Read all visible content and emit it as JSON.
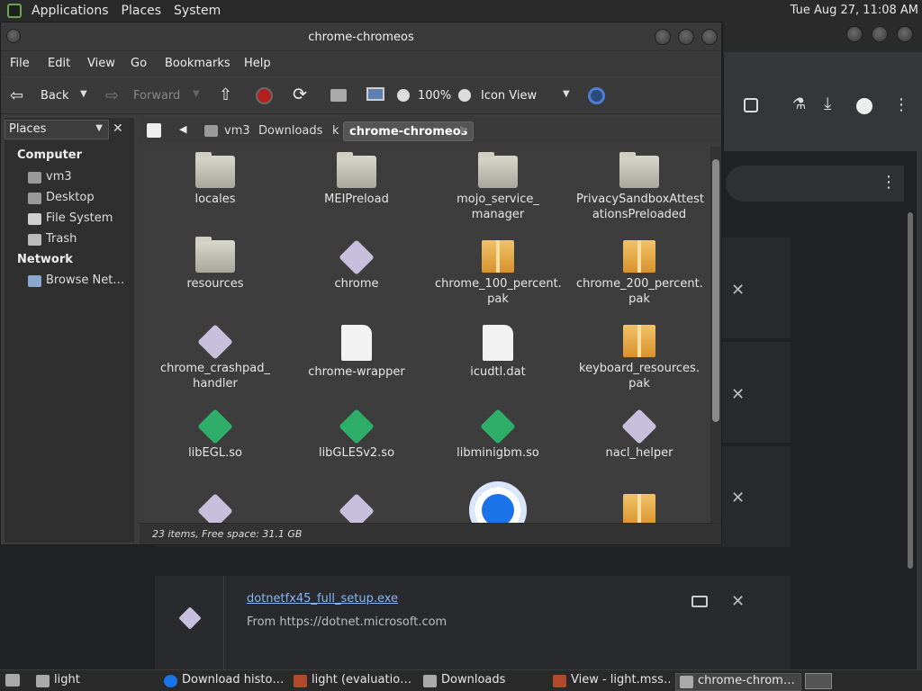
{
  "top_panel": {
    "menus": [
      "Applications",
      "Places",
      "System"
    ],
    "clock": "Tue Aug 27, 11:08 AM"
  },
  "file_manager": {
    "title": "chrome-chromeos",
    "menubar": [
      "File",
      "Edit",
      "View",
      "Go",
      "Bookmarks",
      "Help"
    ],
    "toolbar": {
      "back": "Back",
      "forward": "Forward",
      "zoom": "100%",
      "view_mode": "Icon View"
    },
    "sidebar": {
      "combo": "Places",
      "headers": {
        "computer": "Computer",
        "network": "Network"
      },
      "items": [
        "vm3",
        "Desktop",
        "File System",
        "Trash",
        "Browse Net…"
      ]
    },
    "path": [
      "vm3",
      "Downloads",
      "k",
      "chrome-chromeos"
    ],
    "status": "23 items, Free space: 31.1 GB",
    "items": [
      {
        "name": "locales",
        "kind": "folder"
      },
      {
        "name": "MEIPreload",
        "kind": "folder"
      },
      {
        "name": "mojo_service_\nmanager",
        "kind": "folder"
      },
      {
        "name": "PrivacySandboxAttest\nationsPreloaded",
        "kind": "folder"
      },
      {
        "name": "resources",
        "kind": "folder"
      },
      {
        "name": "chrome",
        "kind": "exec"
      },
      {
        "name": "chrome_100_percent.\npak",
        "kind": "package"
      },
      {
        "name": "chrome_200_percent.\npak",
        "kind": "package"
      },
      {
        "name": "chrome_crashpad_\nhandler",
        "kind": "exec"
      },
      {
        "name": "chrome-wrapper",
        "kind": "script"
      },
      {
        "name": "icudtl.dat",
        "kind": "document"
      },
      {
        "name": "keyboard_resources.\npak",
        "kind": "package"
      },
      {
        "name": "libEGL.so",
        "kind": "library"
      },
      {
        "name": "libGLESv2.so",
        "kind": "library"
      },
      {
        "name": "libminigbm.so",
        "kind": "library"
      },
      {
        "name": "nacl_helper",
        "kind": "exec"
      }
    ]
  },
  "download_page": {
    "file_link": "dotnetfx45_full_setup.exe",
    "source": "From https://dotnet.microsoft.com"
  },
  "taskbar": {
    "tasks": [
      "light",
      "Download histo…",
      "light (evaluatio…",
      "Downloads",
      "View - light.mss…",
      "chrome-chrom…"
    ]
  },
  "colors": {
    "folder": "#c5c5b8",
    "package": "#e4a640",
    "library": "#2fae6a",
    "exec": "#c8bfdc",
    "chrome_blue": "#1a73e8"
  }
}
